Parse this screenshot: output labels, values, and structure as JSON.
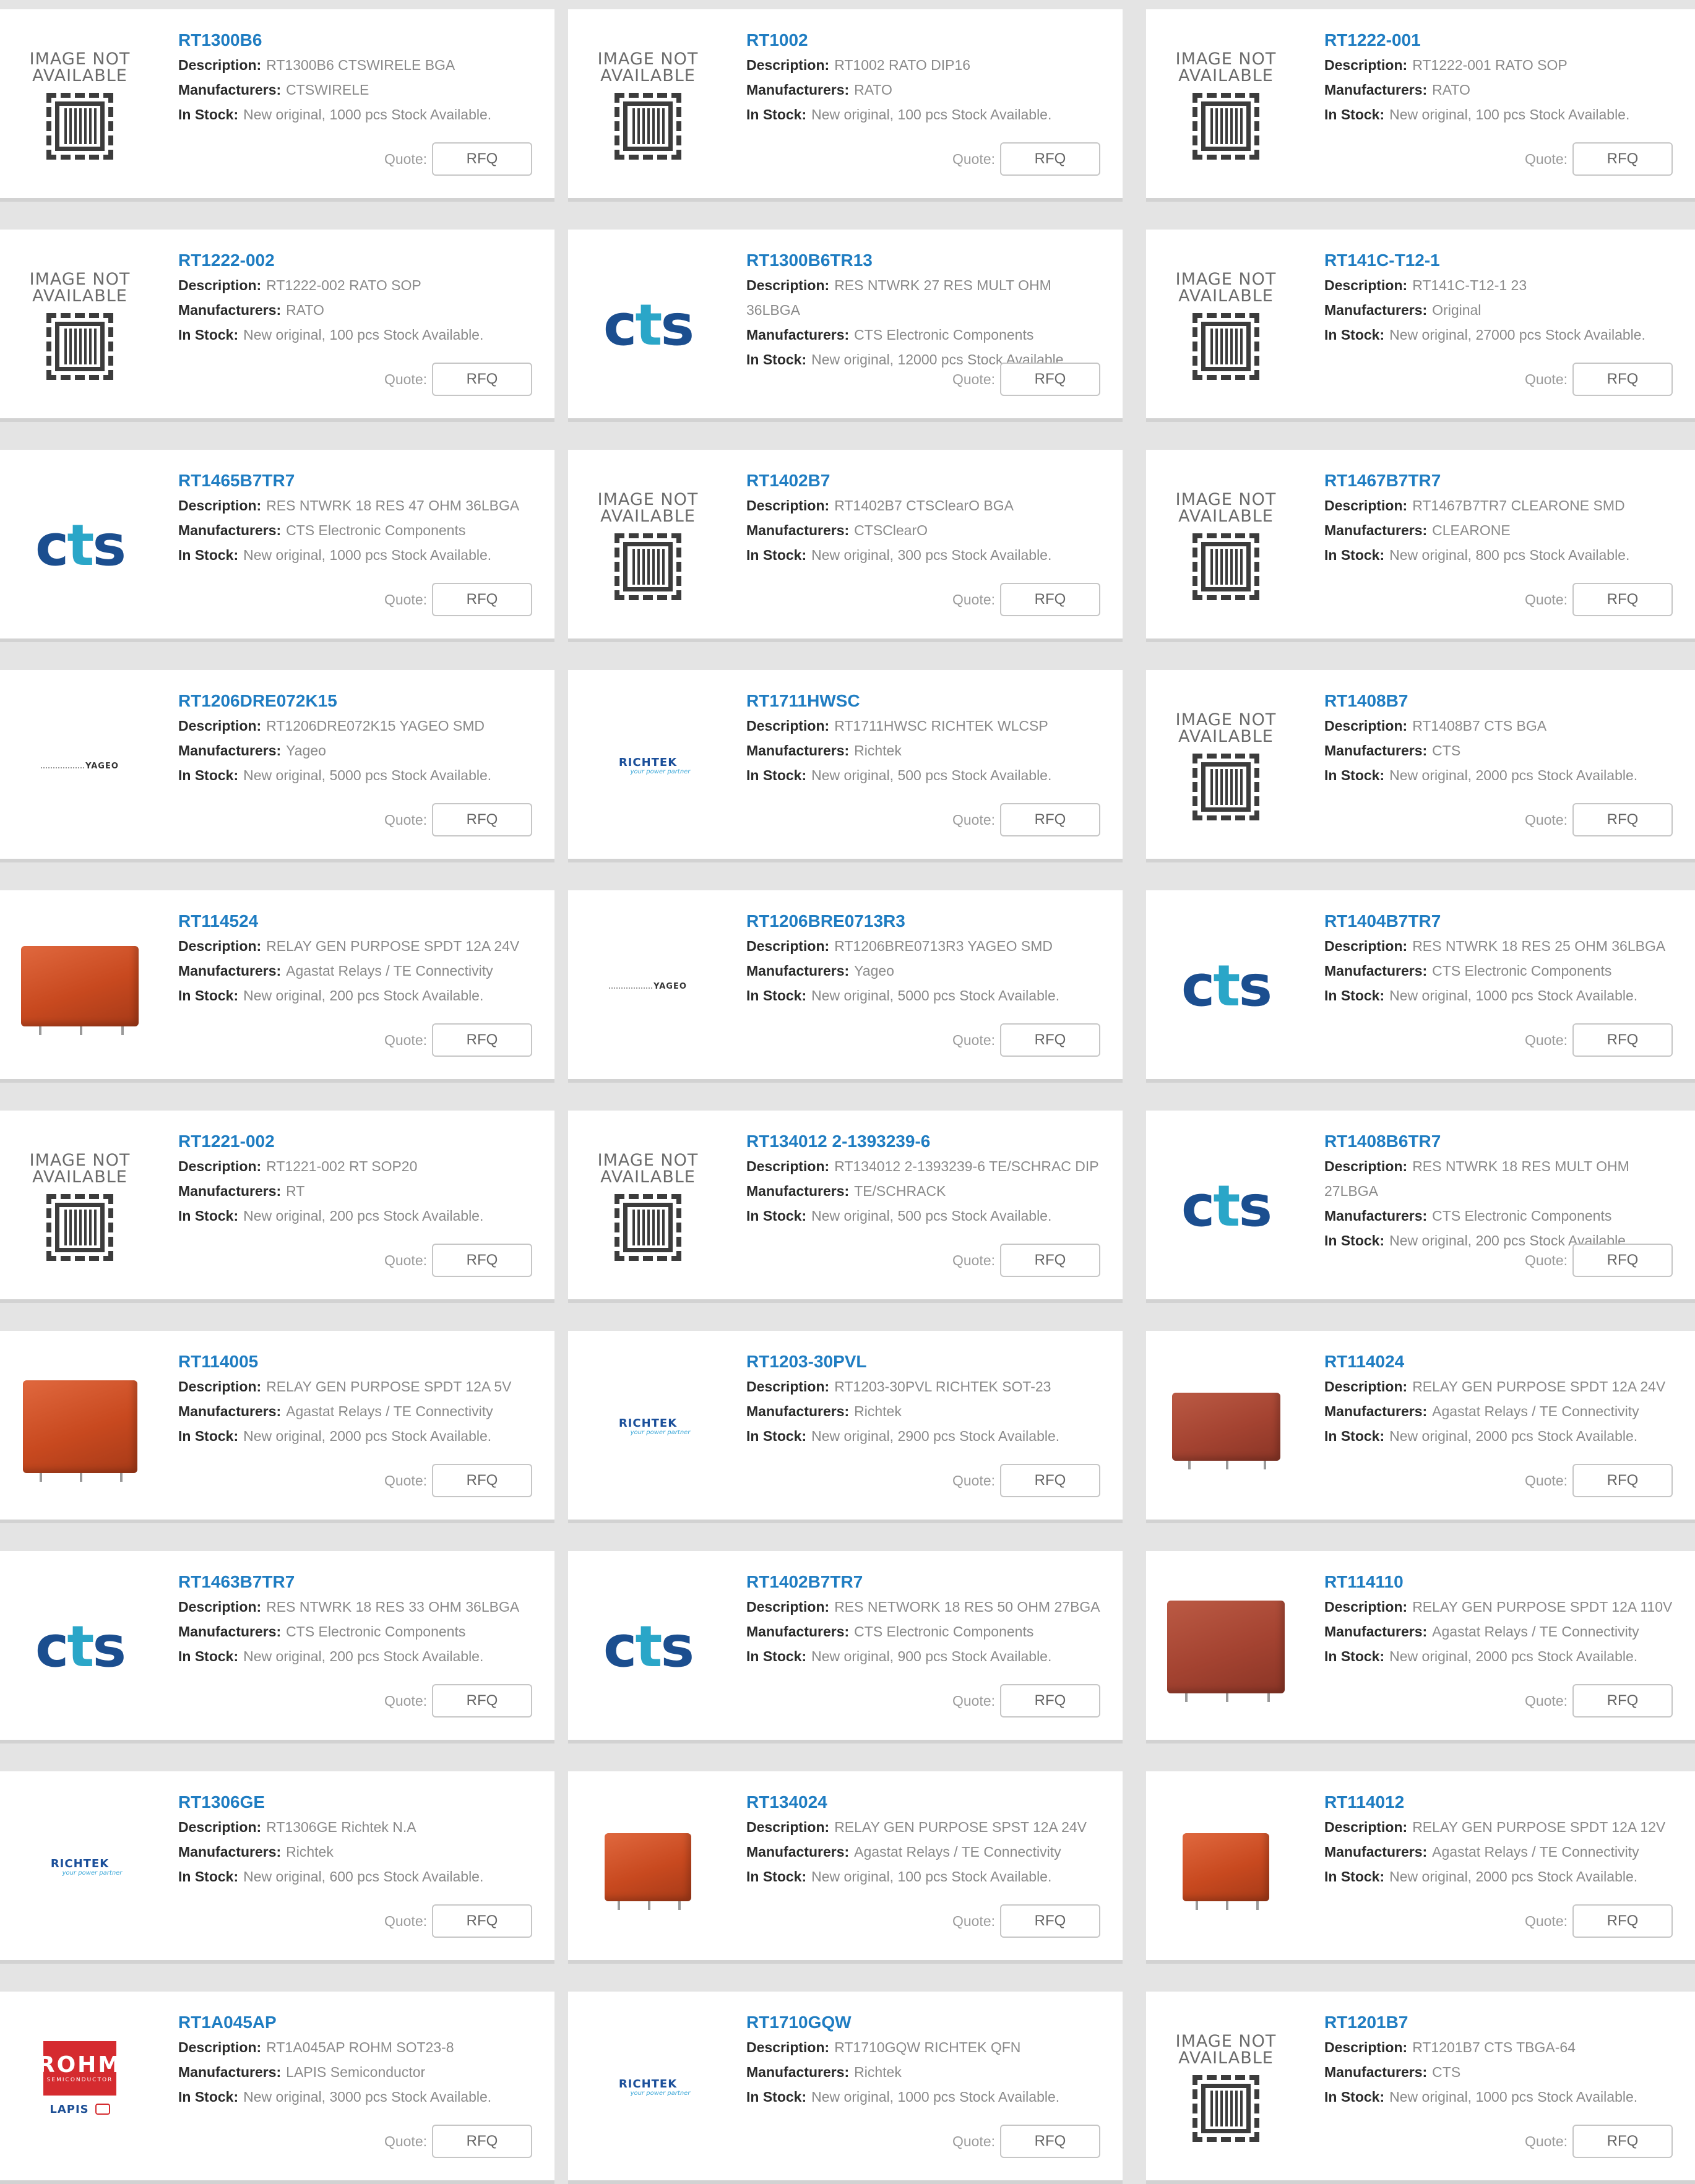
{
  "labels": {
    "description": "Description:",
    "manufacturers": "Manufacturers:",
    "in_stock": "In Stock:",
    "quote": "Quote:",
    "rfq": "RFQ",
    "image_na_line1": "IMAGE NOT",
    "image_na_line2": "AVAILABLE"
  },
  "logos": {
    "cts": "cts",
    "richtek": "RICHTEK",
    "richtek_tagline": "your power partner",
    "yageo": "YAGEO",
    "rohm": "ROHM",
    "rohm_sub": "SEMICONDUCTOR",
    "lapis": "LAPIS"
  },
  "colors": {
    "part_link": "#1f7dc2",
    "cts_blue": "#1b4e8f",
    "relay_orange": "#c8491f",
    "rohm_red": "#d52b2f"
  },
  "products": [
    {
      "pn": "RT1300B6",
      "desc": "RT1300B6 CTSWIRELE BGA",
      "mfr": "CTSWIRELE",
      "stock": "New original, 1000 pcs Stock Available.",
      "img": "na"
    },
    {
      "pn": "RT1002",
      "desc": "RT1002 RATO DIP16",
      "mfr": "RATO",
      "stock": "New original, 100 pcs Stock Available.",
      "img": "na"
    },
    {
      "pn": "RT1222-001",
      "desc": "RT1222-001 RATO SOP",
      "mfr": "RATO",
      "stock": "New original, 100 pcs Stock Available.",
      "img": "na"
    },
    {
      "pn": "RT1222-002",
      "desc": "RT1222-002 RATO SOP",
      "mfr": "RATO",
      "stock": "New original, 100 pcs Stock Available.",
      "img": "na"
    },
    {
      "pn": "RT1300B6TR13",
      "desc": "RES NTWRK 27 RES MULT OHM 36LBGA",
      "mfr": "CTS Electronic Components",
      "stock": "New original, 12000 pcs Stock Available.",
      "img": "cts"
    },
    {
      "pn": "RT141C-T12-1",
      "desc": "RT141C-T12-1 23",
      "mfr": "Original",
      "stock": "New original, 27000 pcs Stock Available.",
      "img": "na"
    },
    {
      "pn": "RT1465B7TR7",
      "desc": "RES NTWRK 18 RES 47 OHM 36LBGA",
      "mfr": "CTS Electronic Components",
      "stock": "New original, 1000 pcs Stock Available.",
      "img": "cts"
    },
    {
      "pn": "RT1402B7",
      "desc": "RT1402B7 CTSClearO BGA",
      "mfr": "CTSClearO",
      "stock": "New original, 300 pcs Stock Available.",
      "img": "na"
    },
    {
      "pn": "RT1467B7TR7",
      "desc": "RT1467B7TR7 CLEARONE SMD",
      "mfr": "CLEARONE",
      "stock": "New original, 800 pcs Stock Available.",
      "img": "na"
    },
    {
      "pn": "RT1206DRE072K15",
      "desc": "RT1206DRE072K15 YAGEO SMD",
      "mfr": "Yageo",
      "stock": "New original, 5000 pcs Stock Available.",
      "img": "yageo"
    },
    {
      "pn": "RT1711HWSC",
      "desc": "RT1711HWSC RICHTEK WLCSP",
      "mfr": "Richtek",
      "stock": "New original, 500 pcs Stock Available.",
      "img": "richtek"
    },
    {
      "pn": "RT1408B7",
      "desc": "RT1408B7 CTS BGA",
      "mfr": "CTS",
      "stock": "New original, 2000 pcs Stock Available.",
      "img": "na"
    },
    {
      "pn": "RT114524",
      "desc": "RELAY GEN PURPOSE SPDT 12A 24V",
      "mfr": "Agastat Relays / TE Connectivity",
      "stock": "New original, 200 pcs Stock Available.",
      "img": "relay-flat"
    },
    {
      "pn": "RT1206BRE0713R3",
      "desc": "RT1206BRE0713R3 YAGEO SMD",
      "mfr": "Yageo",
      "stock": "New original, 5000 pcs Stock Available.",
      "img": "yageo"
    },
    {
      "pn": "RT1404B7TR7",
      "desc": "RES NTWRK 18 RES 25 OHM 36LBGA",
      "mfr": "CTS Electronic Components",
      "stock": "New original, 1000 pcs Stock Available.",
      "img": "cts"
    },
    {
      "pn": "RT1221-002",
      "desc": "RT1221-002 RT SOP20",
      "mfr": "RT",
      "stock": "New original, 200 pcs Stock Available.",
      "img": "na"
    },
    {
      "pn": "RT134012 2-1393239-6",
      "desc": "RT134012 2-1393239-6 TE/SCHRAC DIP",
      "mfr": "TE/SCHRACK",
      "stock": "New original, 500 pcs Stock Available.",
      "img": "na"
    },
    {
      "pn": "RT1408B6TR7",
      "desc": "RES NTWRK 18 RES MULT OHM 27LBGA",
      "mfr": "CTS Electronic Components",
      "stock": "New original, 200 pcs Stock Available.",
      "img": "cts"
    },
    {
      "pn": "RT114005",
      "desc": "RELAY GEN PURPOSE SPDT 12A 5V",
      "mfr": "Agastat Relays / TE Connectivity",
      "stock": "New original, 2000 pcs Stock Available.",
      "img": "relay-iso"
    },
    {
      "pn": "RT1203-30PVL",
      "desc": "RT1203-30PVL RICHTEK SOT-23",
      "mfr": "Richtek",
      "stock": "New original, 2900 pcs Stock Available.",
      "img": "richtek"
    },
    {
      "pn": "RT114024",
      "desc": "RELAY GEN PURPOSE SPDT 12A 24V",
      "mfr": "Agastat Relays / TE Connectivity",
      "stock": "New original, 2000 pcs Stock Available.",
      "img": "relay-front"
    },
    {
      "pn": "RT1463B7TR7",
      "desc": "RES NTWRK 18 RES 33 OHM 36LBGA",
      "mfr": "CTS Electronic Components",
      "stock": "New original, 200 pcs Stock Available.",
      "img": "cts"
    },
    {
      "pn": "RT1402B7TR7",
      "desc": "RES NETWORK 18 RES 50 OHM 27BGA",
      "mfr": "CTS Electronic Components",
      "stock": "New original, 900 pcs Stock Available.",
      "img": "cts"
    },
    {
      "pn": "RT114110",
      "desc": "RELAY GEN PURPOSE SPDT 12A 110V",
      "mfr": "Agastat Relays / TE Connectivity",
      "stock": "New original, 2000 pcs Stock Available.",
      "img": "relay-big"
    },
    {
      "pn": "RT1306GE",
      "desc": "RT1306GE Richtek N.A",
      "mfr": "Richtek",
      "stock": "New original, 600 pcs Stock Available.",
      "img": "richtek"
    },
    {
      "pn": "RT134024",
      "desc": "RELAY GEN PURPOSE SPST 12A 24V",
      "mfr": "Agastat Relays / TE Connectivity",
      "stock": "New original, 100 pcs Stock Available.",
      "img": "relay-small"
    },
    {
      "pn": "RT114012",
      "desc": "RELAY GEN PURPOSE SPDT 12A 12V",
      "mfr": "Agastat Relays / TE Connectivity",
      "stock": "New original, 2000 pcs Stock Available.",
      "img": "relay-small"
    },
    {
      "pn": "RT1A045AP",
      "desc": "RT1A045AP ROHM SOT23-8",
      "mfr": "LAPIS Semiconductor",
      "stock": "New original, 3000 pcs Stock Available.",
      "img": "rohm"
    },
    {
      "pn": "RT1710GQW",
      "desc": "RT1710GQW RICHTEK QFN",
      "mfr": "Richtek",
      "stock": "New original, 1000 pcs Stock Available.",
      "img": "richtek"
    },
    {
      "pn": "RT1201B7",
      "desc": "RT1201B7 CTS TBGA-64",
      "mfr": "CTS",
      "stock": "New original, 1000 pcs Stock Available.",
      "img": "na"
    }
  ]
}
